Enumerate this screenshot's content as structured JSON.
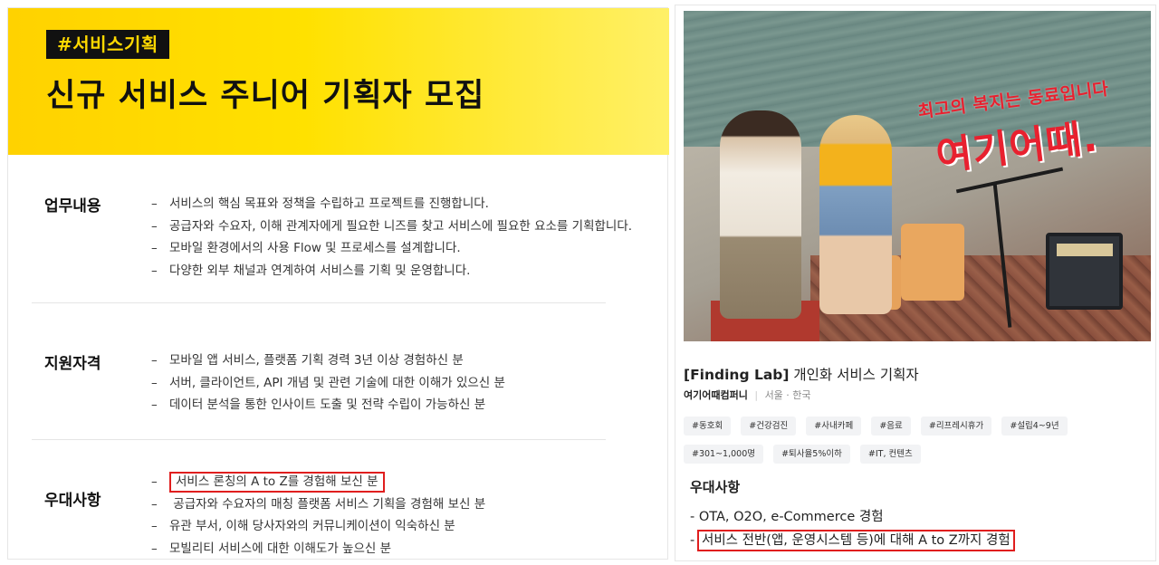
{
  "left": {
    "hero": {
      "tag": "#서비스기획",
      "title": "신규 서비스 주니어 기획자 모집"
    },
    "sections": [
      {
        "label": "업무내용",
        "items": [
          "서비스의 핵심 목표와 정책을 수립하고 프로젝트를 진행합니다.",
          "공급자와 수요자, 이해 관계자에게 필요한 니즈를 찾고 서비스에 필요한 요소를 기획합니다.",
          "모바일 환경에서의 사용 Flow 및 프로세스를 설계합니다.",
          "다양한 외부 채널과 연계하여 서비스를 기획 및 운영합니다."
        ]
      },
      {
        "label": "지원자격",
        "items": [
          "모바일 앱 서비스, 플랫폼 기획 경력 3년 이상 경험하신 분",
          "서버, 클라이언트, API 개념 및 관련 기술에 대한 이해가 있으신 분",
          "데이터 분석을 통한 인사이트 도출 및 전략 수립이 가능하신 분"
        ]
      },
      {
        "label": "우대사항",
        "items": [
          "서비스 론칭의 A to Z를 경험해 보신 분",
          " 공급자와 수요자의 매칭 플랫폼 서비스 기획을 경험해 보신 분",
          "유관 부서, 이해 당사자와의 커뮤니케이션이 익숙하신 분",
          "모빌리티 서비스에 대한 이해도가 높으신 분"
        ]
      }
    ],
    "dash": "–"
  },
  "right": {
    "photo": {
      "subtitle": "최고의 복지는 동료입니다",
      "brand": "여기어때."
    },
    "job": {
      "title_bracket": "[Finding Lab]",
      "title_rest": " 개인화 서비스 기획자",
      "company": "여기어때컴퍼니",
      "separator": "|",
      "location": "서울 · 한국"
    },
    "tags": [
      "#동호회",
      "#건강검진",
      "#사내카페",
      "#음료",
      "#리프레시휴가",
      "#설립4~9년",
      "#301~1,000명",
      "#퇴사율5%이하",
      "#IT, 컨텐츠"
    ],
    "preferred": {
      "title": "우대사항",
      "items": [
        "OTA, O2O, e-Commerce 경험",
        "서비스 전반(앱, 운영시스템 등)에 대해 A to Z까지 경험"
      ],
      "dash": "-"
    }
  },
  "colors": {
    "hero_yellow": "#ffd800",
    "highlight_red": "#e01e1e",
    "brand_red": "#e8212f"
  }
}
